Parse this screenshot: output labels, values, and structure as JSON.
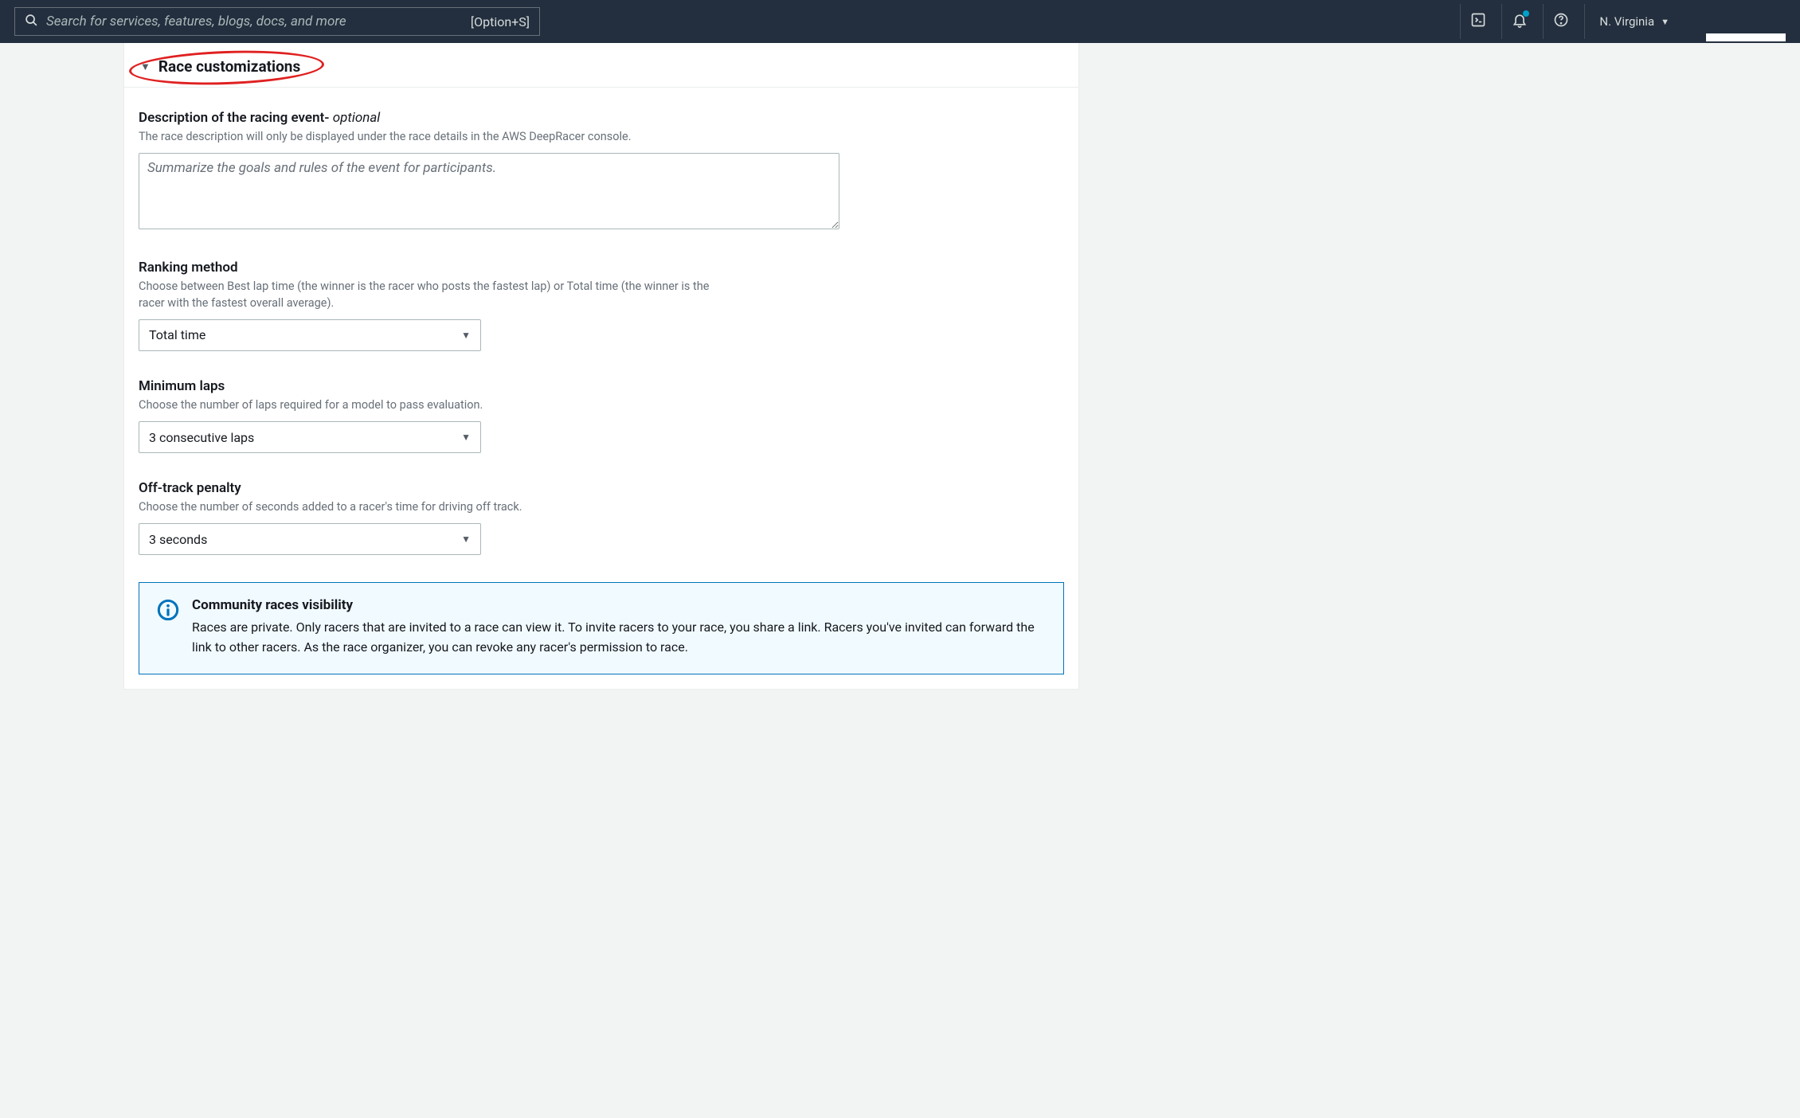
{
  "topbar": {
    "search_placeholder": "Search for services, features, blogs, docs, and more",
    "search_shortcut": "[Option+S]",
    "region": "N. Virginia"
  },
  "section": {
    "title": "Race customizations"
  },
  "fields": {
    "description": {
      "label_main": "Description of the racing event- ",
      "label_optional": "optional",
      "help": "The race description will only be displayed under the race details in the AWS DeepRacer console.",
      "placeholder": "Summarize the goals and rules of the event for participants."
    },
    "ranking": {
      "label": "Ranking method",
      "help": "Choose between Best lap time (the winner is the racer who posts the fastest lap) or Total time (the winner is the racer with the fastest overall average).",
      "value": "Total time"
    },
    "minlaps": {
      "label": "Minimum laps",
      "help": "Choose the number of laps required for a model to pass evaluation.",
      "value": "3 consecutive laps"
    },
    "penalty": {
      "label": "Off-track penalty",
      "help": "Choose the number of seconds added to a racer's time for driving off track.",
      "value": "3 seconds"
    }
  },
  "info": {
    "title": "Community races visibility",
    "body": "Races are private. Only racers that are invited to a race can view it. To invite racers to your race, you share a link. Racers you've invited can forward the link to other racers. As the race organizer, you can revoke any racer's permission to race."
  }
}
